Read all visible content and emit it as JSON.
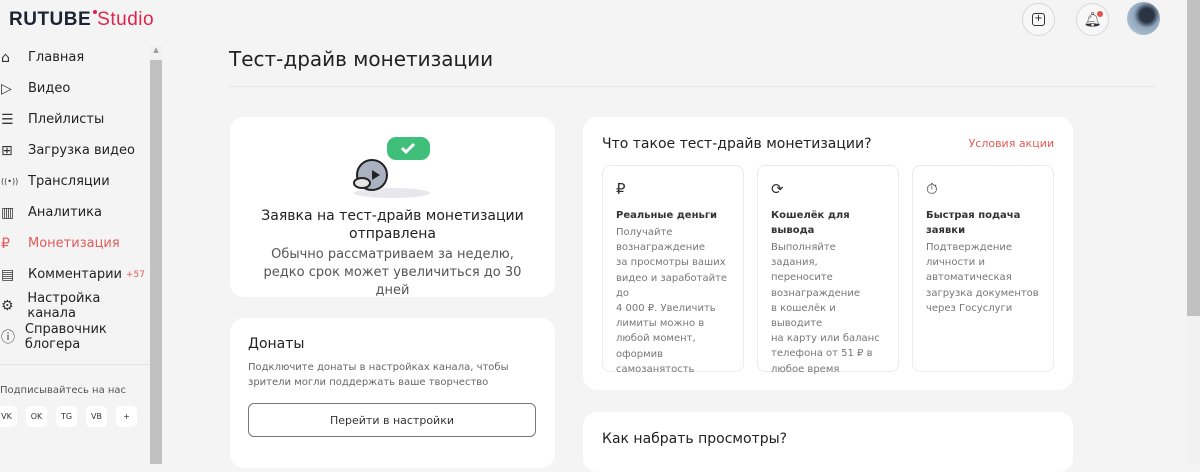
{
  "header": {
    "logo_main": "RUTUBE",
    "logo_sub": "Studio"
  },
  "sidebar": {
    "items": [
      {
        "label": "Главная",
        "icon": "⌂"
      },
      {
        "label": "Видео",
        "icon": "▷"
      },
      {
        "label": "Плейлисты",
        "icon": "☰"
      },
      {
        "label": "Загрузка видео",
        "icon": "⊞"
      },
      {
        "label": "Трансляции",
        "icon": "((•))"
      },
      {
        "label": "Аналитика",
        "icon": "▥"
      },
      {
        "label": "Монетизация",
        "icon": "₽"
      },
      {
        "label": "Комментарии",
        "icon": "▤",
        "badge": "+57"
      },
      {
        "label": "Настройка канала",
        "icon": "⚙"
      },
      {
        "label": "Справочник блогера",
        "icon": "ⓘ"
      }
    ],
    "follow_label": "Подписывайтесь на нас",
    "socials": [
      "VK",
      "OK",
      "TG",
      "VB",
      "+"
    ]
  },
  "page": {
    "title": "Тест-драйв монетизации"
  },
  "application": {
    "title": "Заявка на тест-драйв монетизации отправлена",
    "subtitle": "Обычно рассматриваем за неделю, редко срок может увеличиться до 30 дней"
  },
  "donations": {
    "title": "Донаты",
    "text": "Подключите донаты в настройках канала, чтобы зрители могли поддержать ваше творчество",
    "button": "Перейти в настройки"
  },
  "whatis": {
    "title": "Что такое тест-драйв монетизации?",
    "link": "Условия акции",
    "features": [
      {
        "icon": "₽",
        "title": "Реальные деньги",
        "text": "Получайте\nвознаграждение\nза просмотры ваших\nвидео и заработайте до\n4 000 ₽. Увеличить\nлимиты можно в\nлюбой момент,\nоформив\nсамозанятость"
      },
      {
        "icon": "⟳",
        "title": "Кошелёк для вывода",
        "text": "Выполняйте задания,\nпереносите\nвознаграждение\nв кошелёк и выводите\nна карту или баланс\nтелефона от 51 ₽ в\nлюбое время"
      },
      {
        "icon": "⏱",
        "title": "Быстрая подача заявки",
        "text": "Подтверждение\nличности и\nавтоматическая\nзагрузка документов\nчерез Госуслуги"
      }
    ]
  },
  "views": {
    "title": "Как набрать просмотры?"
  }
}
